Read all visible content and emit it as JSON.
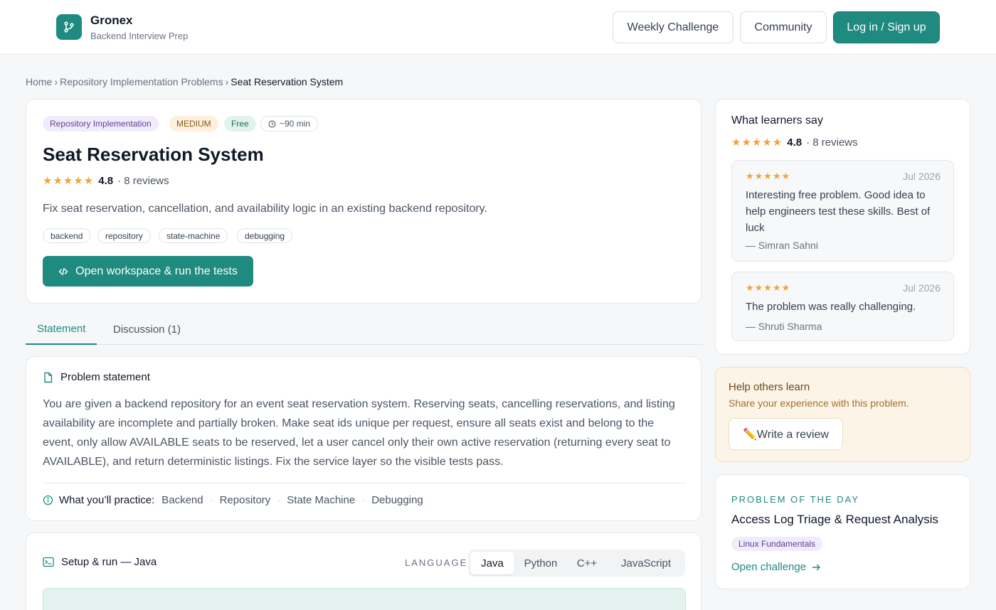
{
  "header": {
    "brand_name": "Gronex",
    "brand_sub": "Backend Interview Prep",
    "nav_weekly": "Weekly Challenge",
    "nav_community": "Community",
    "nav_login": "Log in / Sign up"
  },
  "breadcrumb": {
    "home": "Home",
    "sep1": "›",
    "section": "Repository Implementation Problems",
    "sep2": "›",
    "current": "Seat Reservation System"
  },
  "problem": {
    "category": "Repository Implementation",
    "difficulty": "MEDIUM",
    "price": "Free",
    "duration": "~90 min",
    "title": "Seat Reservation System",
    "stars": "★★★★★",
    "rating": "4.8",
    "reviews": "· 8 reviews",
    "description": "Fix seat reservation, cancellation, and availability logic in an existing backend repository.",
    "tags": [
      "backend",
      "repository",
      "state-machine",
      "debugging"
    ],
    "open_button": "Open workspace & run the tests"
  },
  "tabs": {
    "statement": "Statement",
    "discussion": "Discussion (1)"
  },
  "statement": {
    "heading": "Problem statement",
    "body": "You are given a backend repository for an event seat reservation system. Reserving seats, cancelling reservations, and listing availability are incomplete and partially broken. Make seat ids unique per request, ensure all seats exist and belong to the event, only allow AVAILABLE seats to be reserved, let a user cancel only their own active reservation (returning every seat to AVAILABLE), and return deterministic listings. Fix the service layer so the visible tests pass.",
    "practice_label": "What you’ll practice:",
    "practice": [
      "Backend",
      "Repository",
      "State Machine",
      "Debugging"
    ],
    "dot": "·"
  },
  "setup": {
    "heading": "Setup & run — Java",
    "language_label": "LANGUAGE",
    "languages": [
      "Java",
      "Python",
      "C++",
      "JavaScript"
    ],
    "selected_language": "Java"
  },
  "sidebar": {
    "reviews_title": "What learners say",
    "stars": "★★★★★",
    "rating": "4.8",
    "reviews_count": "· 8 reviews",
    "items": [
      {
        "stars": "★★★★★",
        "date": "Jul 2026",
        "text": "Interesting free problem. Good idea to help engineers test these skills. Best of luck",
        "author": "— Simran Sahni"
      },
      {
        "stars": "★★★★★",
        "date": "Jul 2026",
        "text": "The problem was really challenging.",
        "author": "— Shruti Sharma"
      }
    ],
    "help_title": "Help others learn",
    "help_sub": "Share your experience with this problem.",
    "write_review": "✏️Write a review",
    "potd_kicker": "PROBLEM OF THE DAY",
    "potd_title": "Access Log Triage & Request Analysis",
    "potd_tag": "Linux Fundamentals",
    "potd_link": "Open challenge"
  },
  "colors": {
    "accent": "#1f8a7f",
    "star": "#f2a23a",
    "purple_pill": "#f1ecfb",
    "medium_pill": "#fdf0dc",
    "free_pill": "#e2f3ed",
    "help_bg": "#fdf4e8"
  },
  "icons": {
    "logo": "git-branch-icon",
    "clock": "clock-icon",
    "code": "code-icon",
    "document": "document-icon",
    "info": "info-icon",
    "terminal": "terminal-icon",
    "arrow": "arrow-right-icon"
  }
}
